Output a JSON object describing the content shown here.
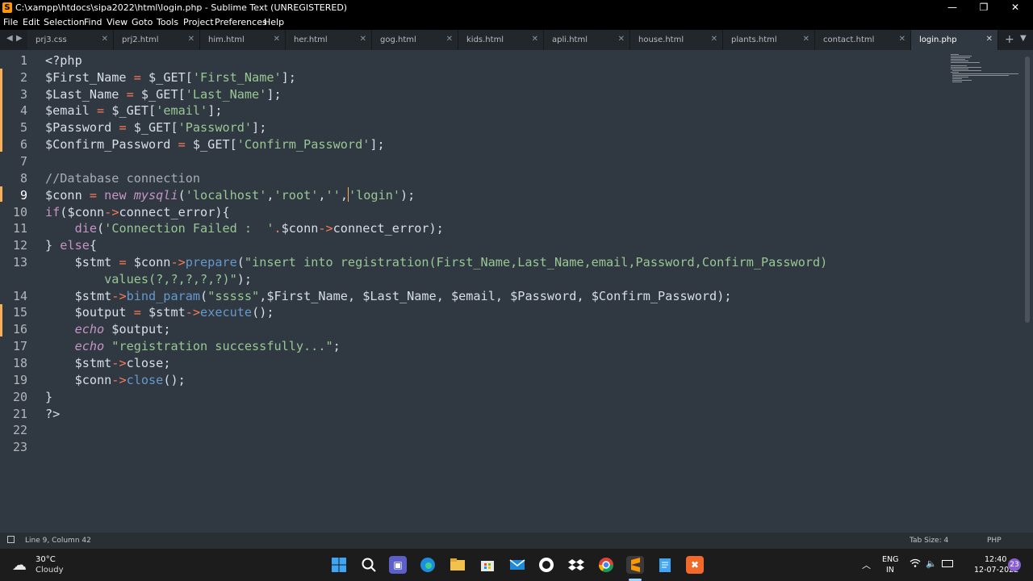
{
  "window": {
    "title": "C:\\xampp\\htdocs\\sipa2022\\html\\login.php - Sublime Text (UNREGISTERED)",
    "controls": [
      "—",
      "❐",
      "✕"
    ]
  },
  "menu": [
    "File",
    "Edit",
    "Selection",
    "Find",
    "View",
    "Goto",
    "Tools",
    "Project",
    "Preferences",
    "Help"
  ],
  "tabs": [
    {
      "label": "prj3.css"
    },
    {
      "label": "prj2.html"
    },
    {
      "label": "him.html"
    },
    {
      "label": "her.html"
    },
    {
      "label": "gog.html"
    },
    {
      "label": "kids.html"
    },
    {
      "label": "apli.html"
    },
    {
      "label": "house.html"
    },
    {
      "label": "plants.html"
    },
    {
      "label": "contact.html"
    },
    {
      "label": "login.php",
      "active": true
    }
  ],
  "gutter": {
    "lines": [
      "1",
      "2",
      "3",
      "4",
      "5",
      "6",
      "7",
      "8",
      "9",
      "10",
      "11",
      "12",
      "13",
      "",
      "14",
      "15",
      "16",
      "17",
      "18",
      "19",
      "20",
      "21",
      "22",
      "23"
    ]
  },
  "code": {
    "l1": "<?php",
    "l2a": "$First_Name",
    "l2b": " = ",
    "l2c": "$_GET",
    "l2d": "[",
    "l2e": "'First_Name'",
    "l2f": "];",
    "l3a": "$Last_Name",
    "l3b": " = ",
    "l3c": "$_GET",
    "l3d": "[",
    "l3e": "'Last_Name'",
    "l3f": "];",
    "l4a": "$email",
    "l4b": " = ",
    "l4c": "$_GET",
    "l4d": "[",
    "l4e": "'email'",
    "l4f": "];",
    "l5a": "$Password",
    "l5b": " = ",
    "l5c": "$_GET",
    "l5d": "[",
    "l5e": "'Password'",
    "l5f": "];",
    "l6a": "$Confirm_Password",
    "l6b": " = ",
    "l6c": "$_GET",
    "l6d": "[",
    "l6e": "'Confirm_Password'",
    "l6f": "];",
    "l8": "//Database connection",
    "l9a": "$conn",
    "l9b": " = ",
    "l9c": "new ",
    "l9d": "mysqli",
    "l9e": "(",
    "l9f": "'localhost'",
    "l9g": ",",
    "l9h": "'root'",
    "l9i": ",",
    "l9j": "''",
    "l9k": ",",
    "l9l": "'login'",
    "l9m": ");",
    "l10a": "if",
    "l10b": "(",
    "l10c": "$conn",
    "l10d": "->",
    "l10e": "connect_error",
    "l10f": "){",
    "l11a": "    die",
    "l11b": "(",
    "l11c": "'Connection Failed :  '",
    "l11d": ".",
    "l11e": "$conn",
    "l11f": "->",
    "l11g": "connect_error",
    "l11h": ");",
    "l12a": "} ",
    "l12b": "else",
    "l12c": "{",
    "l13a": "    $stmt",
    "l13b": " = ",
    "l13c": "$conn",
    "l13d": "->",
    "l13e": "prepare",
    "l13f": "(",
    "l13g": "\"insert into registration(First_Name,Last_Name,email,Password,Confirm_Password)",
    "l13h": "        values(?,?,?,?,?)\"",
    "l13i": ");",
    "l14a": "    $stmt",
    "l14b": "->",
    "l14c": "bind_param",
    "l14d": "(",
    "l14e": "\"sssss\"",
    "l14f": ",",
    "l14g": "$First_Name",
    "l14h": ", ",
    "l14i": "$Last_Name",
    "l14j": ", ",
    "l14k": "$email",
    "l14l": ", ",
    "l14m": "$Password",
    "l14n": ", ",
    "l14o": "$Confirm_Password",
    "l14p": ");",
    "l15a": "    $output",
    "l15b": " = ",
    "l15c": "$stmt",
    "l15d": "->",
    "l15e": "execute",
    "l15f": "();",
    "l16a": "    echo ",
    "l16b": "$output",
    "l16c": ";",
    "l17a": "    echo ",
    "l17b": "\"registration successfully...\"",
    "l17c": ";",
    "l18a": "    $stmt",
    "l18b": "->",
    "l18c": "close",
    "l18d": ";",
    "l19a": "    $conn",
    "l19b": "->",
    "l19c": "close",
    "l19d": "();",
    "l20": "}",
    "l21": "?>"
  },
  "status": {
    "position": "Line 9, Column 42",
    "tab_size": "Tab Size: 4",
    "syntax": "PHP"
  },
  "taskbar": {
    "weather_temp": "30°C",
    "weather_desc": "Cloudy",
    "lang_top": "ENG",
    "lang_bottom": "IN",
    "time": "12:40",
    "date": "12-07-2022",
    "notif": "23"
  },
  "colors": {
    "editor_bg": "#303841",
    "accent": "#f9ae58"
  }
}
